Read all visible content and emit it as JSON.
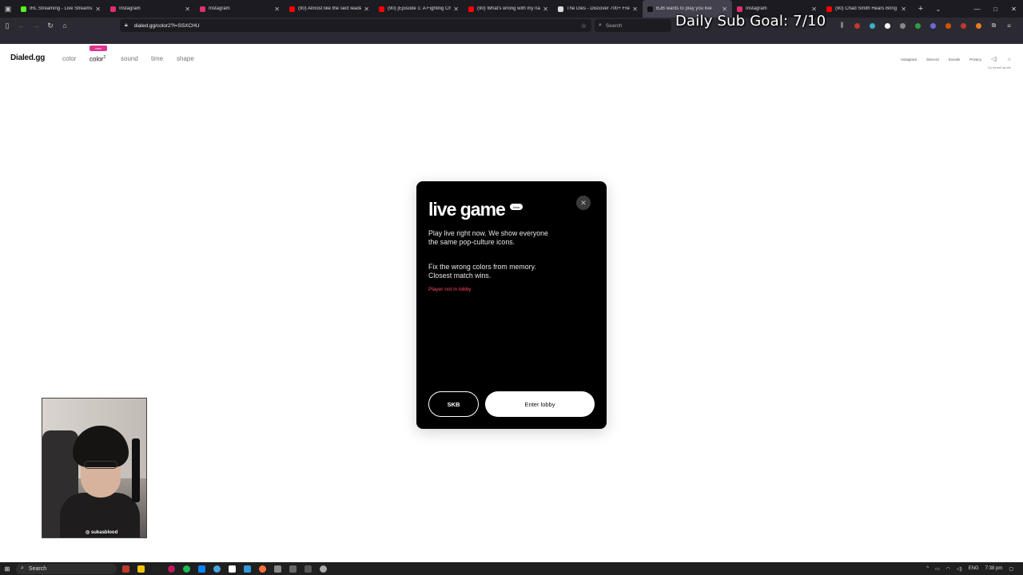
{
  "browser": {
    "tabs": [
      {
        "title": "IRL Streaming - Live Streams on",
        "color": "#53fc18",
        "active": false
      },
      {
        "title": "Instagram",
        "color": "#e1306c",
        "active": false
      },
      {
        "title": "Instagram",
        "color": "#e1306c",
        "active": false
      },
      {
        "title": "(90) Almost like the sect leader",
        "color": "#ff0000",
        "active": false
      },
      {
        "title": "(90) [Episode 1: A Fighting Cha",
        "color": "#ff0000",
        "active": false
      },
      {
        "title": "(90) What's wrong with my nam",
        "color": "#ff0000",
        "active": false
      },
      {
        "title": "The Dles - Discover 700+ Free",
        "color": "#dddddd",
        "active": false
      },
      {
        "title": "BJB wants to play you live",
        "color": "#111111",
        "active": true
      },
      {
        "title": "Instagram",
        "color": "#e1306c",
        "active": false
      },
      {
        "title": "(90) Chad Smith Hears Bring M",
        "color": "#ff0000",
        "active": false
      }
    ],
    "url": "dialed.gg/color2?l=SSXCHU",
    "search_placeholder": "Search",
    "new_tab": "+",
    "close_glyph": "✕"
  },
  "stream_overlay": {
    "goal_text": "Daily Sub Goal: 7/10"
  },
  "site": {
    "logo": "Dialed.gg",
    "nav": [
      {
        "label": "color",
        "active": false
      },
      {
        "label": "color",
        "sup": "2",
        "active": true
      },
      {
        "label": "sound",
        "active": false
      },
      {
        "label": "time",
        "active": false
      },
      {
        "label": "shape",
        "active": false
      }
    ],
    "new_badge": "new",
    "right_links": [
      "Instagram",
      "Discord",
      "Socials",
      "Privacy"
    ],
    "right_note": "Do not sell my info"
  },
  "modal": {
    "title": "live game",
    "badge": "beta",
    "close": "✕",
    "paragraph1": "Play live right now. We show everyone the same pop-culture icons.",
    "paragraph2": "Fix the wrong colors from memory. Closest match wins.",
    "status": "Player not in lobby",
    "status_color": "#ff4b5c",
    "secondary_button": "SKB",
    "primary_button": "Enter lobby"
  },
  "webcam": {
    "handle": "◎ sukasblood"
  },
  "taskbar": {
    "search": "Search",
    "language": "ENG",
    "time": "7:38 pm"
  }
}
